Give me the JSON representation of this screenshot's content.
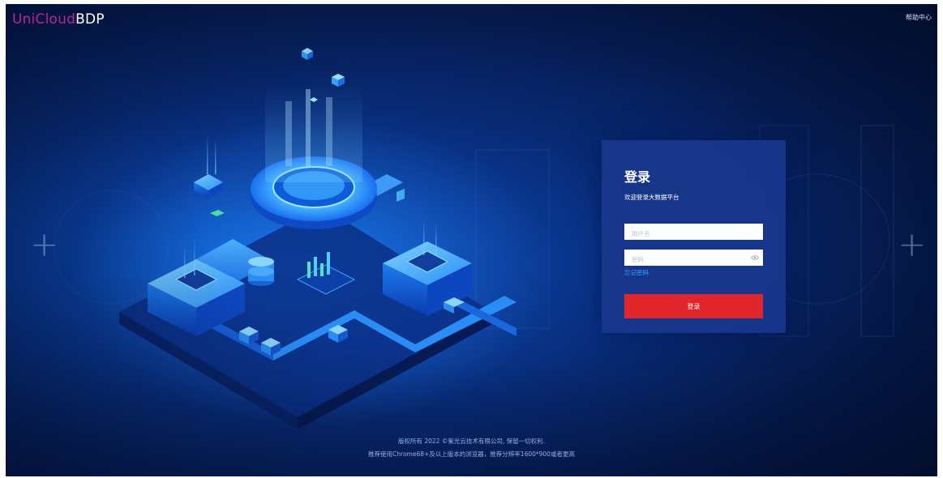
{
  "brand": {
    "name_part1": "UniCloud",
    "name_part2": "BDP",
    "color_part1": "#b8269b"
  },
  "header": {
    "help_link": "帮助中心"
  },
  "login": {
    "title": "登录",
    "subtitle": "欢迎登录大数据平台",
    "username_placeholder": "用户名",
    "password_placeholder": "密码",
    "forgot_password": "忘记密码",
    "submit_label": "登录",
    "submit_color": "#e0262a"
  },
  "footer": {
    "copyright": "版权所有 2022 ©紫光云技术有限公司, 保留一切权利.",
    "browser_tip": "推荐使用Chrome68+及以上版本的浏览器，推荐分辨率1600*900或者更高"
  },
  "icons": {
    "password_toggle": "eye-icon"
  }
}
